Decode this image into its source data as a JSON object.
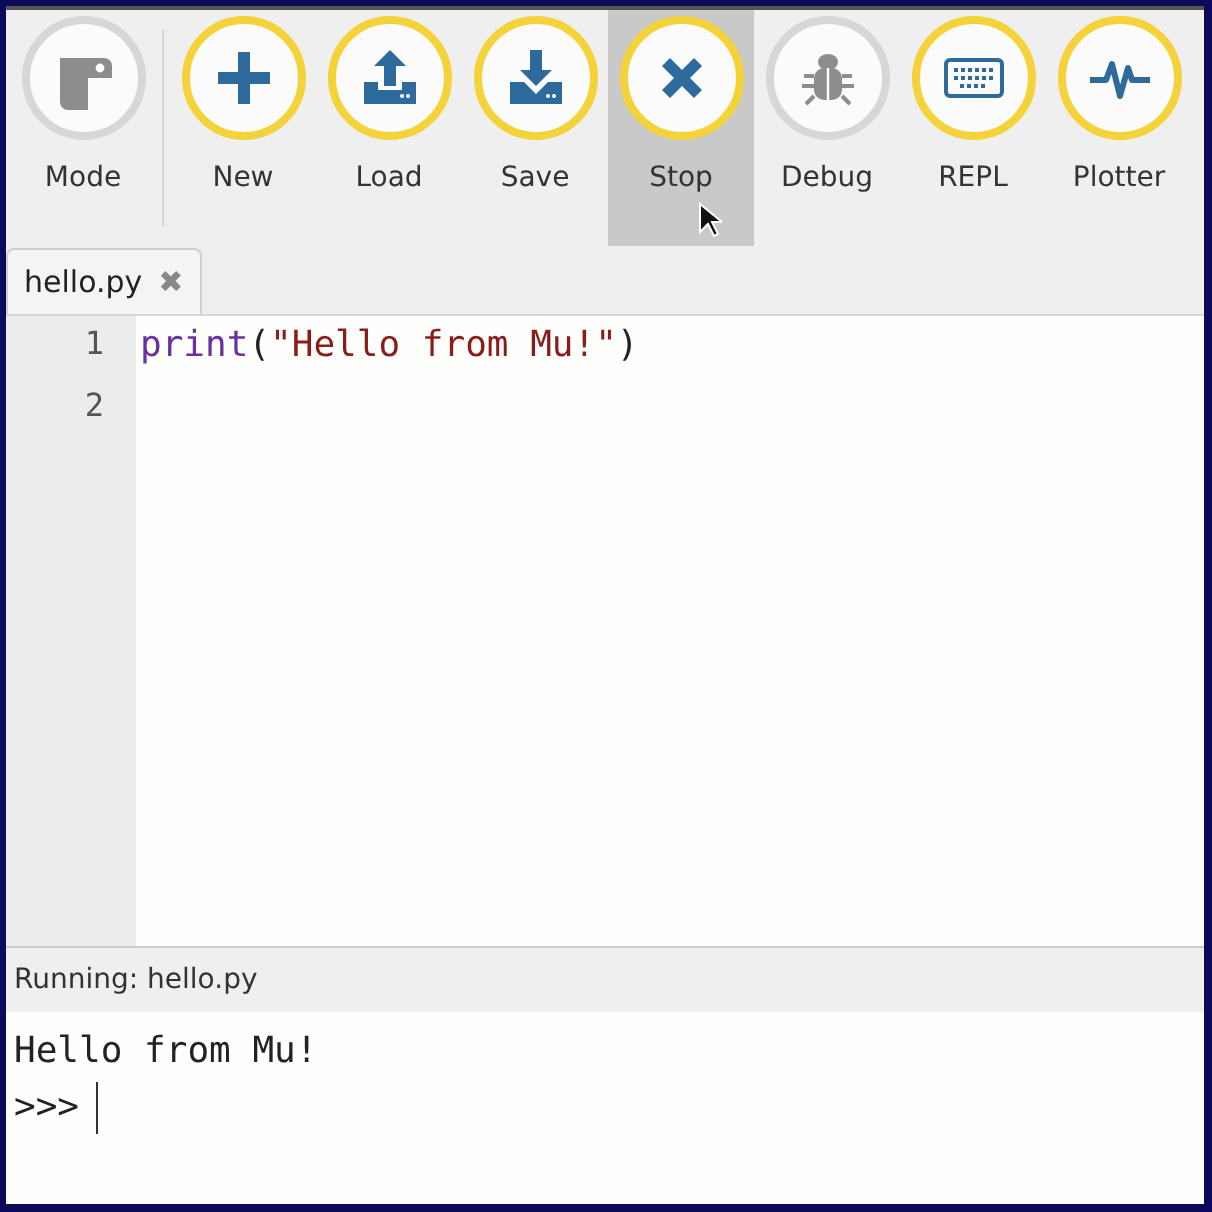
{
  "toolbar": {
    "buttons": [
      {
        "label": "Mode",
        "kind": "mode",
        "disabled": true,
        "hovered": false
      },
      {
        "label": "New",
        "kind": "new",
        "disabled": false,
        "hovered": false
      },
      {
        "label": "Load",
        "kind": "load",
        "disabled": false,
        "hovered": false
      },
      {
        "label": "Save",
        "kind": "save",
        "disabled": false,
        "hovered": false
      },
      {
        "label": "Stop",
        "kind": "stop",
        "disabled": false,
        "hovered": true
      },
      {
        "label": "Debug",
        "kind": "debug",
        "disabled": true,
        "hovered": false
      },
      {
        "label": "REPL",
        "kind": "repl",
        "disabled": false,
        "hovered": false
      },
      {
        "label": "Plotter",
        "kind": "plotter",
        "disabled": false,
        "hovered": false
      }
    ]
  },
  "tabs": [
    {
      "label": "hello.py",
      "selected": true,
      "close": "✖"
    }
  ],
  "editor": {
    "lines": [
      {
        "number": "1",
        "tokens": [
          {
            "kind": "builtin",
            "text": "print"
          },
          {
            "kind": "plain",
            "text": "("
          },
          {
            "kind": "string",
            "text": "\"Hello from Mu!\""
          },
          {
            "kind": "plain",
            "text": ")"
          }
        ]
      },
      {
        "number": "2"
      }
    ]
  },
  "repl": {
    "title": "Running: hello.py",
    "output": [
      "Hello from Mu!"
    ],
    "prompt": ">>>"
  }
}
